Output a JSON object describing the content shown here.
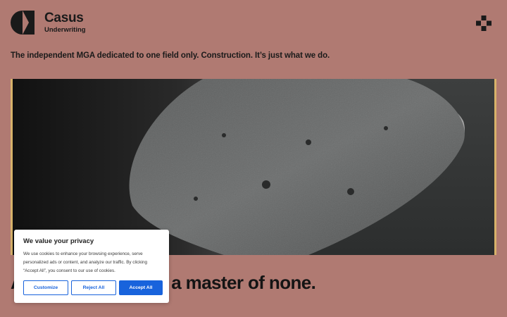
{
  "brand": {
    "name": "Casus",
    "sub": "Underwriting"
  },
  "tagline": "The independent MGA dedicated to one field only. Construction. It’s just what we do.",
  "headline": "A                         a master of none.",
  "headline_visible": "a master of none.",
  "headline_lead": "A",
  "cookie": {
    "title": "We value your privacy",
    "body": "We use cookies to enhance your browsing experience, serve personalized ads or content, and analyze our traffic. By clicking “Accept All”, you consent to our use of cookies.",
    "customize": "Customize",
    "reject": "Reject All",
    "accept": "Accept All"
  },
  "colors": {
    "background": "#b07a72",
    "accent_border": "#d8b26a",
    "button_blue": "#1863dc"
  },
  "icons": {
    "logo": "casus-c-logo-icon",
    "menu": "plus-cross-menu-icon"
  }
}
